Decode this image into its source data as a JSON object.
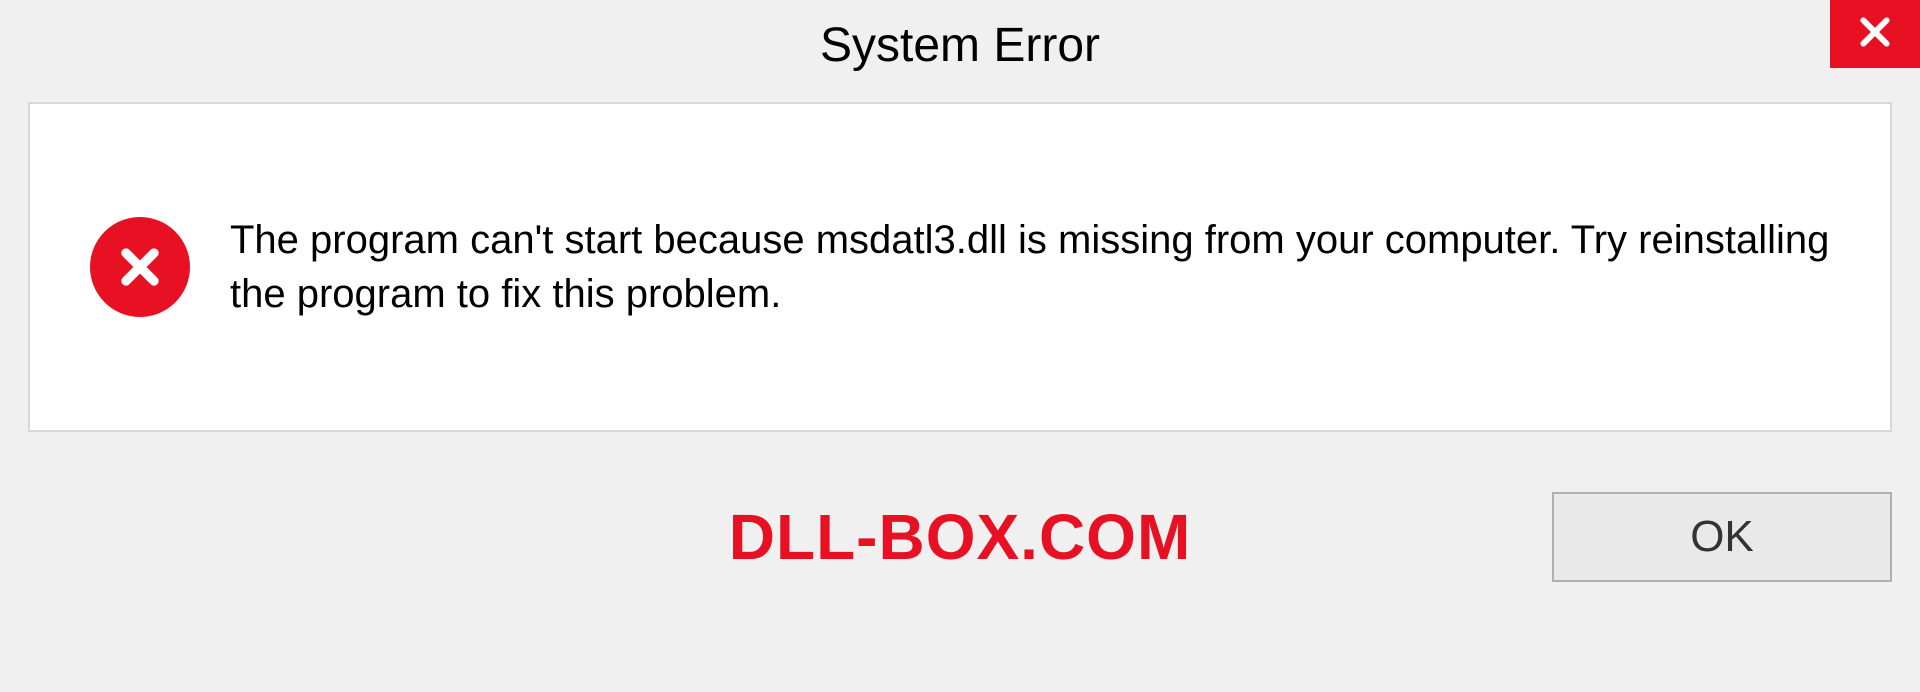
{
  "titlebar": {
    "title": "System Error",
    "close_icon": "close-icon"
  },
  "dialog": {
    "error_icon": "error-x-icon",
    "message": "The program can't start because msdatl3.dll is missing from your computer. Try reinstalling the program to fix this problem."
  },
  "footer": {
    "watermark": "DLL-BOX.COM",
    "ok_label": "OK"
  },
  "colors": {
    "accent_red": "#e81123",
    "background": "#f0f0f0",
    "content_bg": "#ffffff",
    "border": "#d8d8d8"
  }
}
